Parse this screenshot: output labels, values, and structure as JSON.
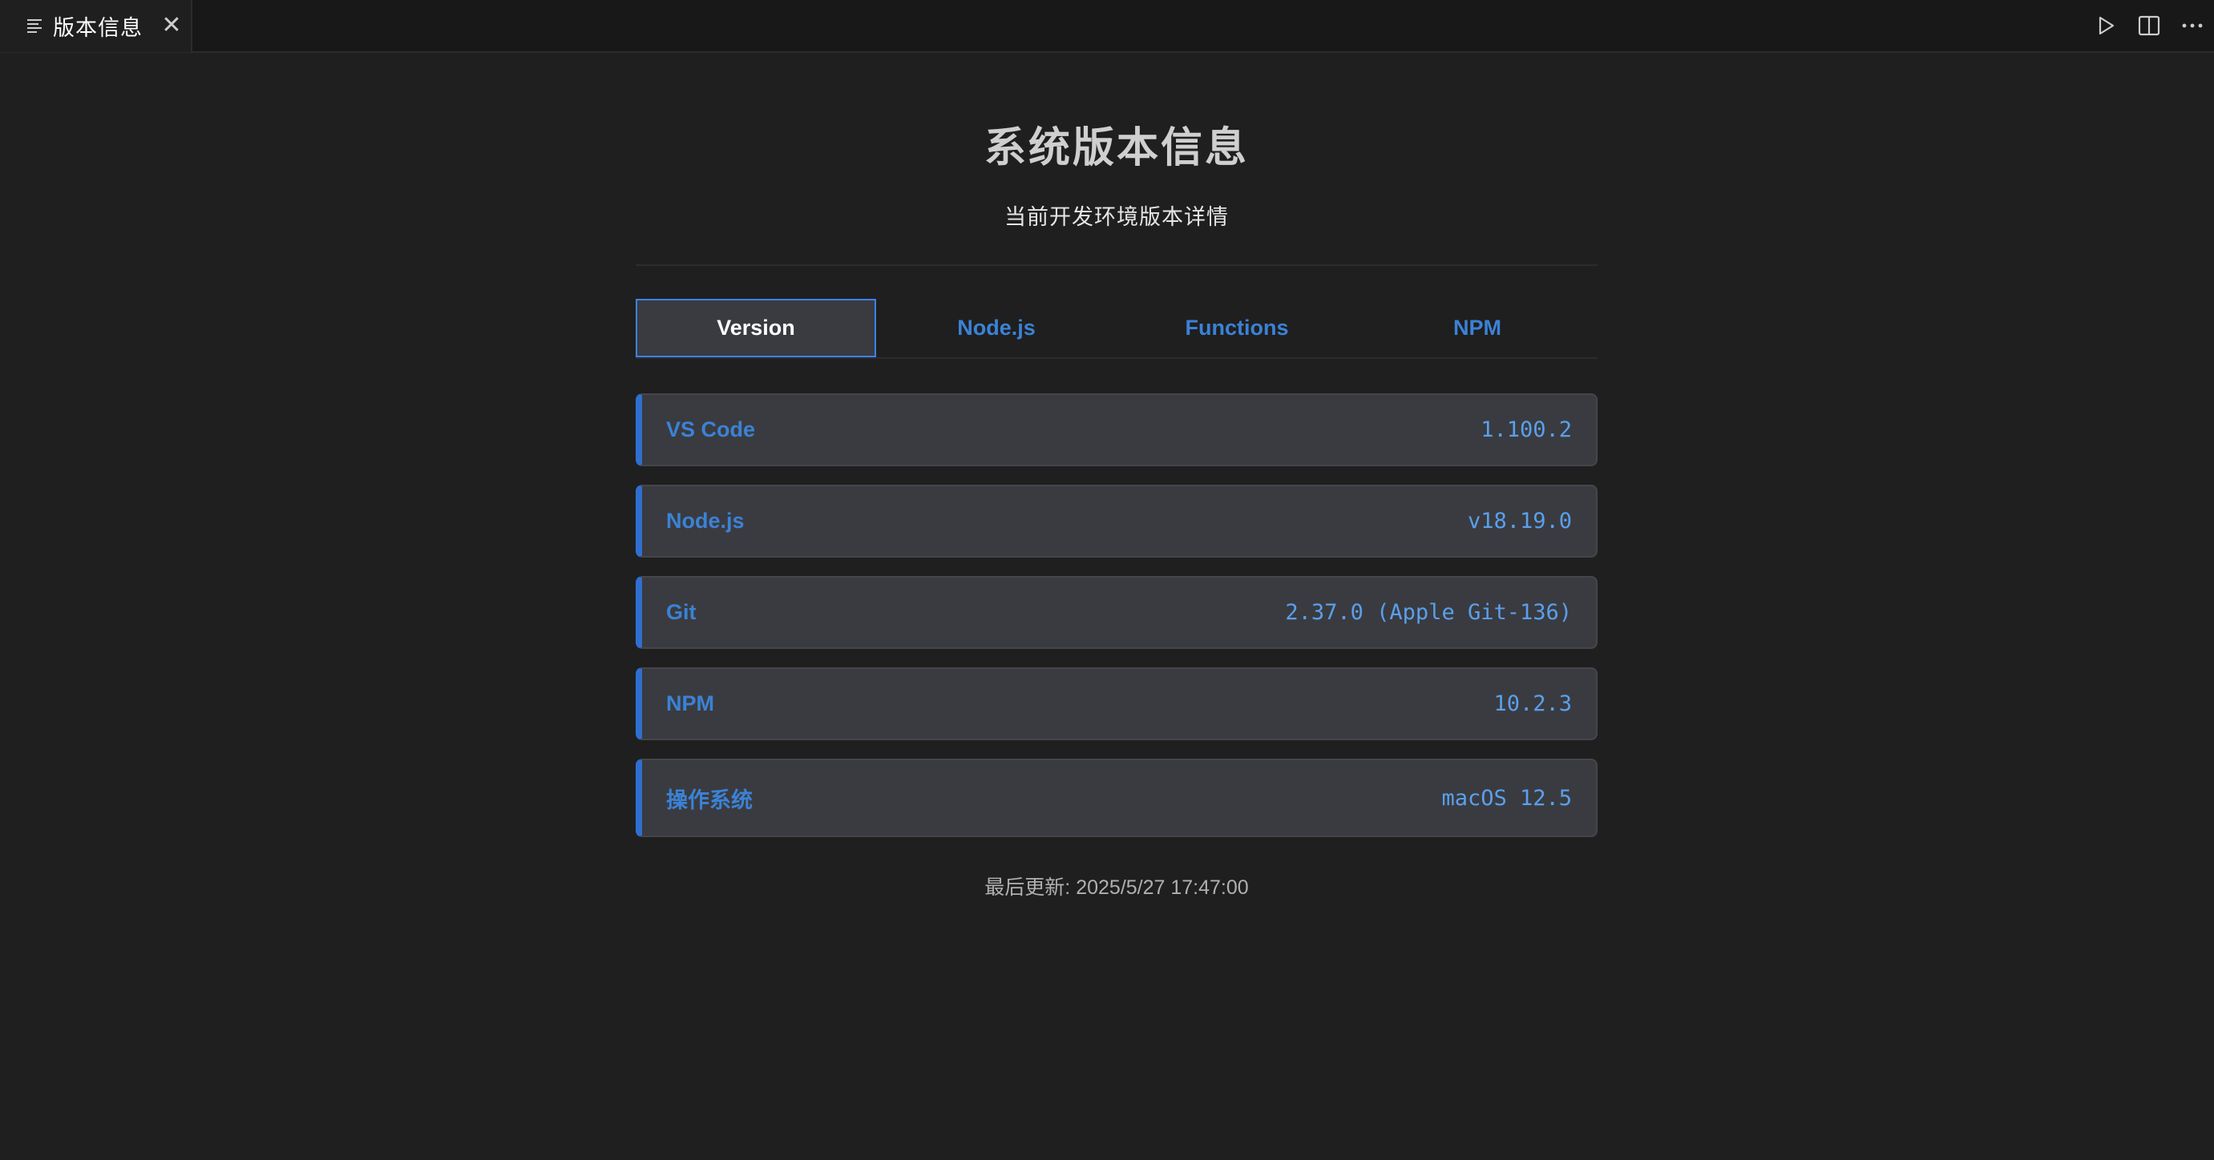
{
  "editor_tab": {
    "title": "版本信息",
    "file_icon": "list-icon",
    "close_icon": "close-icon",
    "close_glyph": "✕"
  },
  "toolbar": {
    "actions": [
      "run-icon",
      "split-editor-icon",
      "more-actions-icon"
    ]
  },
  "header": {
    "title": "系统版本信息",
    "subtitle": "当前开发环境版本详情"
  },
  "tabs": [
    {
      "label": "Version",
      "active": true
    },
    {
      "label": "Node.js",
      "active": false
    },
    {
      "label": "Functions",
      "active": false
    },
    {
      "label": "NPM",
      "active": false
    }
  ],
  "rows": [
    {
      "label": "VS Code",
      "value": "1.100.2"
    },
    {
      "label": "Node.js",
      "value": "v18.19.0"
    },
    {
      "label": "Git",
      "value": "2.37.0 (Apple Git-136)"
    },
    {
      "label": "NPM",
      "value": "10.2.3"
    },
    {
      "label": "操作系统",
      "value": "macOS 12.5"
    }
  ],
  "footer": {
    "last_updated_label": "最后更新: ",
    "last_updated_value": "2025/5/27 17:47:00"
  },
  "colors": {
    "accent": "#3b82f6",
    "label": "#3b82d6",
    "value": "#5aa0ec",
    "card_bg": "#3a3b40",
    "page_bg": "#1f1f1f"
  }
}
